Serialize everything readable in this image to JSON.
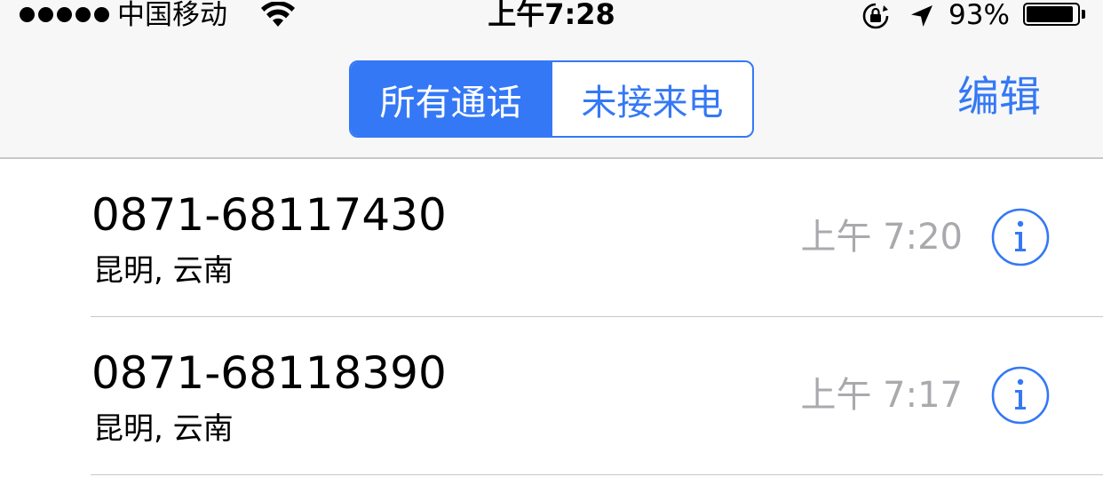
{
  "status_bar": {
    "carrier": "中国移动",
    "time": "上午7:28",
    "battery_percent": "93%",
    "battery_level": 0.93,
    "signal_bars": 5,
    "icons": [
      "wifi-icon",
      "rotation-lock-icon",
      "location-arrow-icon",
      "battery-icon"
    ]
  },
  "nav_bar": {
    "segments": [
      {
        "label": "所有通话",
        "selected": true
      },
      {
        "label": "未接来电",
        "selected": false
      }
    ],
    "edit_label": "编辑",
    "accent_color": "#3478f6"
  },
  "calls": [
    {
      "number": "0871-68117430",
      "location": "昆明, 云南",
      "time": "上午 7:20",
      "info_icon": "info-icon"
    },
    {
      "number": "0871-68118390",
      "location": "昆明, 云南",
      "time": "上午 7:17",
      "info_icon": "info-icon"
    }
  ]
}
